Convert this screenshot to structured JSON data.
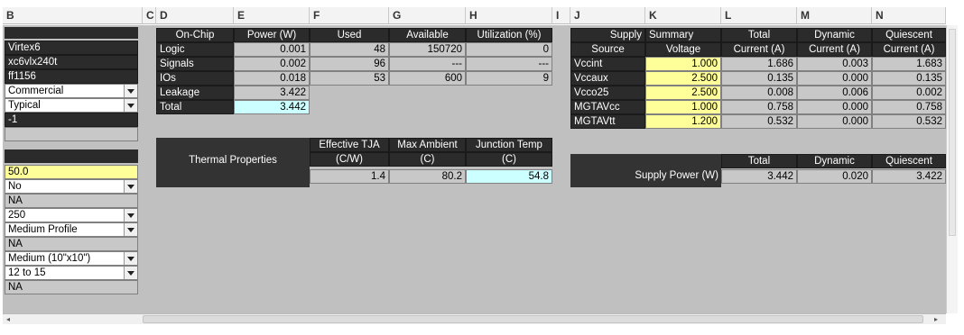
{
  "columns": [
    "B",
    "C",
    "D",
    "E",
    "F",
    "G",
    "H",
    "I",
    "J",
    "K",
    "L",
    "M",
    "N"
  ],
  "settings": {
    "device_family": "Virtex6",
    "device": "xc6vlx240t",
    "package": "ff1156",
    "temp_grade": "Commercial",
    "process": "Typical",
    "speed_grade": "-1",
    "ambient_temp": "50.0",
    "opt1": "No",
    "opt1_na": "NA",
    "opt2": "250",
    "heatsink": "Medium Profile",
    "heatsink_na": "NA",
    "board": "Medium (10\"x10\")",
    "layers": "12 to 15",
    "layers_na": "NA"
  },
  "onchip": {
    "headers": [
      "On-Chip",
      "Power (W)",
      "Used",
      "Available",
      "Utilization (%)"
    ],
    "rows": [
      {
        "name": "Logic",
        "power": "0.001",
        "used": "48",
        "avail": "150720",
        "util": "0"
      },
      {
        "name": "Signals",
        "power": "0.002",
        "used": "96",
        "avail": "---",
        "util": "---"
      },
      {
        "name": "IOs",
        "power": "0.018",
        "used": "53",
        "avail": "600",
        "util": "9"
      },
      {
        "name": "Leakage",
        "power": "3.422",
        "used": "",
        "avail": "",
        "util": ""
      },
      {
        "name": "Total",
        "power": "3.442",
        "used": "",
        "avail": "",
        "util": ""
      }
    ]
  },
  "thermal": {
    "label": "Thermal  Properties",
    "h1a": "Effective TJA",
    "h1b": "(C/W)",
    "h2a": "Max Ambient",
    "h2b": "(C)",
    "h3a": "Junction Temp",
    "h3b": "(C)",
    "tja": "1.4",
    "max_ambient": "80.2",
    "junction_temp": "54.8"
  },
  "supply": {
    "title1": "Supply  Summary",
    "h_source": "Source",
    "h_voltage": "Voltage",
    "h_total1": "Total",
    "h_total2": "Current (A)",
    "h_dyn1": "Dynamic",
    "h_dyn2": "Current (A)",
    "h_qui1": "Quiescent",
    "h_qui2": "Current (A)",
    "rows": [
      {
        "src": "Vccint",
        "v": "1.000",
        "t": "1.686",
        "d": "0.003",
        "q": "1.683"
      },
      {
        "src": "Vccaux",
        "v": "2.500",
        "t": "0.135",
        "d": "0.000",
        "q": "0.135"
      },
      {
        "src": "Vcco25",
        "v": "2.500",
        "t": "0.008",
        "d": "0.006",
        "q": "0.002"
      },
      {
        "src": "MGTAVcc",
        "v": "1.000",
        "t": "0.758",
        "d": "0.000",
        "q": "0.758"
      },
      {
        "src": "MGTAVtt",
        "v": "1.200",
        "t": "0.532",
        "d": "0.000",
        "q": "0.532"
      }
    ]
  },
  "supply_power": {
    "h_total": "Total",
    "h_dyn": "Dynamic",
    "h_qui": "Quiescent",
    "label": "Supply  Power (W)",
    "total": "3.442",
    "dynamic": "0.020",
    "quiescent": "3.422"
  },
  "scroll": {
    "left": "◂",
    "right": "▸"
  }
}
